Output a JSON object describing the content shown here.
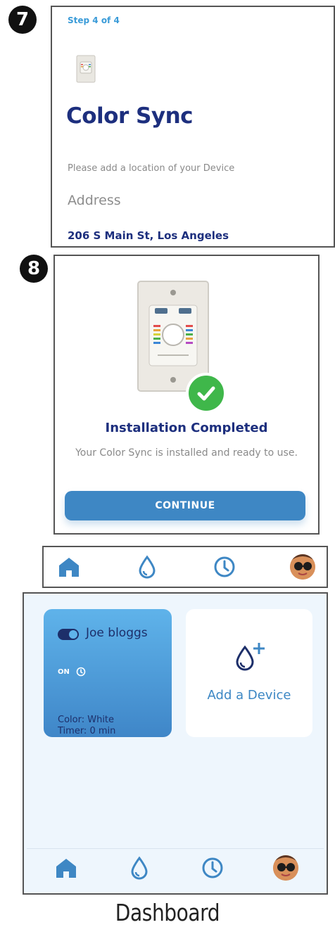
{
  "badges": {
    "step7": "7",
    "step8": "8"
  },
  "panel7": {
    "step": "Step 4 of 4",
    "title": "Color Sync",
    "description": "Please add a location of your  Device",
    "address_label": "Address",
    "address_value": "206 S Main St, Los Angeles"
  },
  "panel8": {
    "title": "Installation Completed",
    "subtitle": "Your Color Sync is installed and ready to use.",
    "continue_label": "CONTINUE"
  },
  "nav": {
    "items": [
      {
        "icon": "home-icon"
      },
      {
        "icon": "drop-icon"
      },
      {
        "icon": "clock-icon"
      },
      {
        "icon": "avatar"
      }
    ]
  },
  "dashboard": {
    "device_card": {
      "name": "Joe bloggs",
      "status": "ON",
      "color": "Color: White",
      "timer": "Timer:  0 min"
    },
    "add_device_label": "Add a Device"
  },
  "caption": "Dashboard",
  "colors": {
    "brand_navy": "#1d2f7e",
    "accent_blue": "#3e87c4",
    "success_green": "#3fb74a",
    "dashboard_bg": "#eef6fd"
  }
}
